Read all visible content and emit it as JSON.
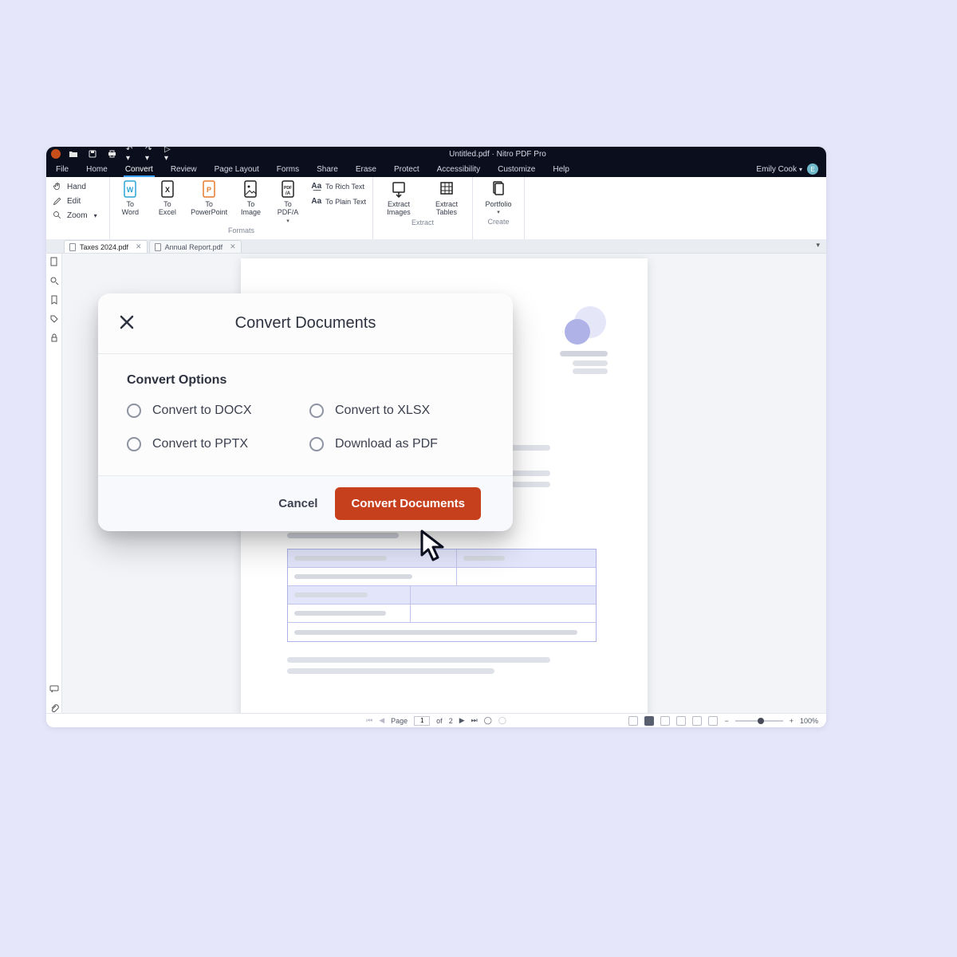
{
  "titlebar": {
    "center_text": "Untitled.pdf · Nitro PDF Pro"
  },
  "menubar": {
    "items": [
      "File",
      "Home",
      "Convert",
      "Review",
      "Page Layout",
      "Forms",
      "Share",
      "Erase",
      "Protect",
      "Accessibility",
      "Customize",
      "Help"
    ],
    "active_index": 2,
    "user_name": "Emily Cook",
    "avatar_initial": "E"
  },
  "quickpane": {
    "hand": "Hand",
    "edit": "Edit",
    "zoom": "Zoom"
  },
  "ribbon": {
    "tools": [
      {
        "label_top": "To",
        "label_bot": "Word",
        "color": "#2aa6d6"
      },
      {
        "label_top": "To",
        "label_bot": "Excel",
        "color": "#222"
      },
      {
        "label_top": "To",
        "label_bot": "PowerPoint",
        "color": "#e57a2c"
      },
      {
        "label_top": "To",
        "label_bot": "Image",
        "color": "#222"
      },
      {
        "label_top": "To",
        "label_bot": "PDF/A",
        "color": "#222",
        "drop": true
      }
    ],
    "richtext": "To Rich Text",
    "plaintext": "To Plain Text",
    "group_formats_label": "Formats",
    "extract": [
      {
        "label_top": "Extract",
        "label_bot": "Images"
      },
      {
        "label_top": "Extract",
        "label_bot": "Tables"
      }
    ],
    "group_extract_label": "Extract",
    "create": [
      {
        "label_top": "Portfolio",
        "label_bot": "",
        "drop": true
      }
    ],
    "group_create_label": "Create"
  },
  "tabs": [
    {
      "filename": "Taxes 2024.pdf",
      "active": true
    },
    {
      "filename": "Annual Report.pdf",
      "active": false
    }
  ],
  "statusbar": {
    "page_label": "Page",
    "page_current": "1",
    "page_sep": "of",
    "page_total": "2",
    "zoom_percent": "100%"
  },
  "dialog": {
    "title": "Convert Documents",
    "options_header": "Convert Options",
    "options": [
      "Convert to DOCX",
      "Convert to XLSX",
      "Convert to PPTX",
      "Download as PDF"
    ],
    "cancel": "Cancel",
    "confirm": "Convert Documents"
  },
  "colors": {
    "accent": "#c7401e"
  }
}
